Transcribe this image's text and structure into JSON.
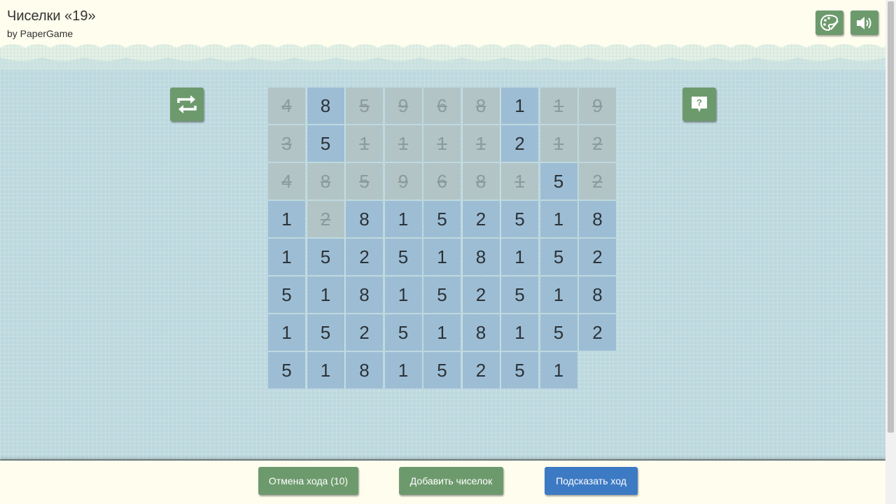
{
  "header": {
    "title": "Чиселки «19»",
    "subtitle": "by PaperGame",
    "theme_icon": "palette-icon",
    "sound_icon": "speaker-icon"
  },
  "side": {
    "restart_icon": "restart-icon",
    "help_icon": "help-icon"
  },
  "grid": {
    "columns": 9,
    "rows": [
      [
        {
          "v": "4",
          "s": "crossed"
        },
        {
          "v": "8",
          "s": "active"
        },
        {
          "v": "5",
          "s": "crossed"
        },
        {
          "v": "9",
          "s": "crossed"
        },
        {
          "v": "6",
          "s": "crossed"
        },
        {
          "v": "8",
          "s": "crossed"
        },
        {
          "v": "1",
          "s": "active"
        },
        {
          "v": "1",
          "s": "crossed"
        },
        {
          "v": "9",
          "s": "crossed"
        }
      ],
      [
        {
          "v": "3",
          "s": "crossed"
        },
        {
          "v": "5",
          "s": "active"
        },
        {
          "v": "1",
          "s": "crossed"
        },
        {
          "v": "1",
          "s": "crossed"
        },
        {
          "v": "1",
          "s": "crossed"
        },
        {
          "v": "1",
          "s": "crossed"
        },
        {
          "v": "2",
          "s": "active"
        },
        {
          "v": "1",
          "s": "crossed"
        },
        {
          "v": "2",
          "s": "crossed"
        }
      ],
      [
        {
          "v": "4",
          "s": "crossed"
        },
        {
          "v": "8",
          "s": "crossed"
        },
        {
          "v": "5",
          "s": "crossed"
        },
        {
          "v": "9",
          "s": "crossed"
        },
        {
          "v": "6",
          "s": "crossed"
        },
        {
          "v": "8",
          "s": "crossed"
        },
        {
          "v": "1",
          "s": "crossed"
        },
        {
          "v": "5",
          "s": "active"
        },
        {
          "v": "2",
          "s": "crossed"
        }
      ],
      [
        {
          "v": "1",
          "s": "active"
        },
        {
          "v": "2",
          "s": "crossed"
        },
        {
          "v": "8",
          "s": "active"
        },
        {
          "v": "1",
          "s": "active"
        },
        {
          "v": "5",
          "s": "active"
        },
        {
          "v": "2",
          "s": "active"
        },
        {
          "v": "5",
          "s": "active"
        },
        {
          "v": "1",
          "s": "active"
        },
        {
          "v": "8",
          "s": "active"
        }
      ],
      [
        {
          "v": "1",
          "s": "active"
        },
        {
          "v": "5",
          "s": "active"
        },
        {
          "v": "2",
          "s": "active"
        },
        {
          "v": "5",
          "s": "active"
        },
        {
          "v": "1",
          "s": "active"
        },
        {
          "v": "8",
          "s": "active"
        },
        {
          "v": "1",
          "s": "active"
        },
        {
          "v": "5",
          "s": "active"
        },
        {
          "v": "2",
          "s": "active"
        }
      ],
      [
        {
          "v": "5",
          "s": "active"
        },
        {
          "v": "1",
          "s": "active"
        },
        {
          "v": "8",
          "s": "active"
        },
        {
          "v": "1",
          "s": "active"
        },
        {
          "v": "5",
          "s": "active"
        },
        {
          "v": "2",
          "s": "active"
        },
        {
          "v": "5",
          "s": "active"
        },
        {
          "v": "1",
          "s": "active"
        },
        {
          "v": "8",
          "s": "active"
        }
      ],
      [
        {
          "v": "1",
          "s": "active"
        },
        {
          "v": "5",
          "s": "active"
        },
        {
          "v": "2",
          "s": "active"
        },
        {
          "v": "5",
          "s": "active"
        },
        {
          "v": "1",
          "s": "active"
        },
        {
          "v": "8",
          "s": "active"
        },
        {
          "v": "1",
          "s": "active"
        },
        {
          "v": "5",
          "s": "active"
        },
        {
          "v": "2",
          "s": "active"
        }
      ],
      [
        {
          "v": "5",
          "s": "active"
        },
        {
          "v": "1",
          "s": "active"
        },
        {
          "v": "8",
          "s": "active"
        },
        {
          "v": "1",
          "s": "active"
        },
        {
          "v": "5",
          "s": "active"
        },
        {
          "v": "2",
          "s": "active"
        },
        {
          "v": "5",
          "s": "active"
        },
        {
          "v": "1",
          "s": "active"
        }
      ]
    ]
  },
  "footer": {
    "undo_label": "Отмена хода (10)",
    "add_label": "Добавить чиселок",
    "hint_label": "Подсказать ход"
  },
  "colors": {
    "button_green": "#6d9a6d",
    "button_blue": "#3d7ac4",
    "cell_active": "#9dbdd4",
    "cell_crossed": "#b2c4c6"
  }
}
